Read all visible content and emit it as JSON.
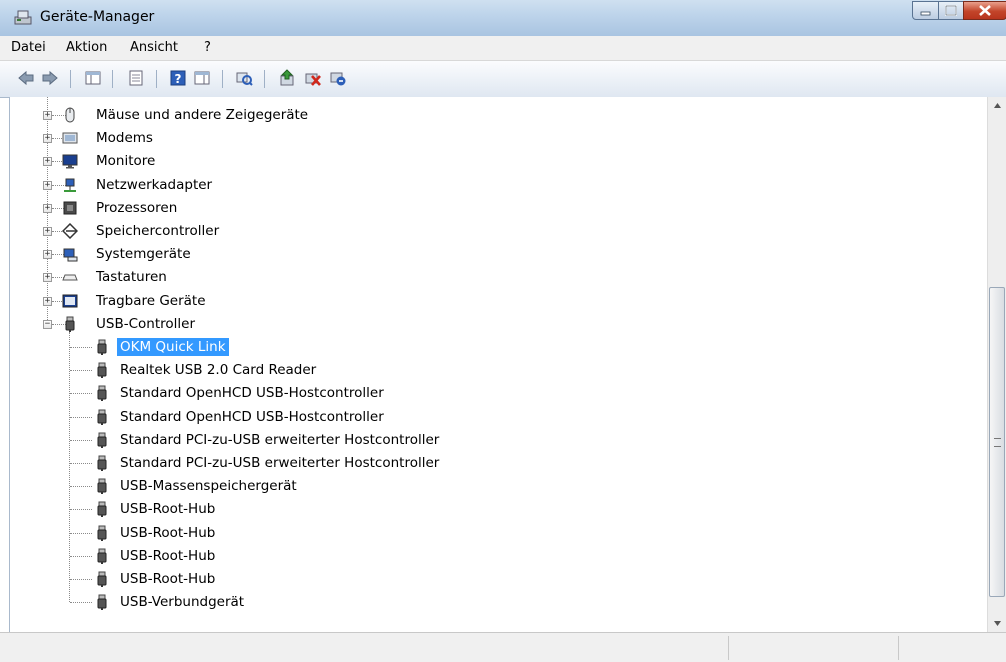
{
  "window": {
    "title": "Geräte-Manager"
  },
  "menu": [
    "Datei",
    "Aktion",
    "Ansicht",
    "?"
  ],
  "toolbar": [
    {
      "name": "back-icon"
    },
    {
      "name": "forward-icon"
    },
    {
      "name": "show-hide-console-tree-icon"
    },
    {
      "name": "properties-icon"
    },
    {
      "name": "help-icon"
    },
    {
      "name": "action-pane-icon"
    },
    {
      "name": "scan-hardware-icon"
    },
    {
      "name": "update-driver-icon"
    },
    {
      "name": "uninstall-device-icon"
    },
    {
      "name": "disable-device-icon"
    }
  ],
  "tree": {
    "categories": [
      {
        "label": "Mäuse und andere Zeigegeräte",
        "icon": "mouse-icon",
        "expander": "+"
      },
      {
        "label": "Modems",
        "icon": "modem-icon",
        "expander": "+"
      },
      {
        "label": "Monitore",
        "icon": "monitor-icon",
        "expander": "+"
      },
      {
        "label": "Netzwerkadapter",
        "icon": "network-adapter-icon",
        "expander": "+"
      },
      {
        "label": "Prozessoren",
        "icon": "processor-icon",
        "expander": "+"
      },
      {
        "label": "Speichercontroller",
        "icon": "storage-controller-icon",
        "expander": "+"
      },
      {
        "label": "Systemgeräte",
        "icon": "system-devices-icon",
        "expander": "+"
      },
      {
        "label": "Tastaturen",
        "icon": "keyboard-icon",
        "expander": "+"
      },
      {
        "label": "Tragbare Geräte",
        "icon": "portable-device-icon",
        "expander": "+"
      },
      {
        "label": "USB-Controller",
        "icon": "usb-icon",
        "expander": "−"
      }
    ],
    "usb_children": [
      "OKM Quick Link",
      "Realtek USB 2.0 Card Reader",
      "Standard OpenHCD USB-Hostcontroller",
      "Standard OpenHCD USB-Hostcontroller",
      "Standard PCI-zu-USB erweiterter Hostcontroller",
      "Standard PCI-zu-USB erweiterter Hostcontroller",
      "USB-Massenspeichergerät",
      "USB-Root-Hub",
      "USB-Root-Hub",
      "USB-Root-Hub",
      "USB-Root-Hub",
      "USB-Verbundgerät"
    ],
    "selected": "OKM Quick Link"
  },
  "colors": {
    "selection": "#3399ff",
    "titlebar": "#bcd3ea",
    "close_button": "#c3452a"
  }
}
